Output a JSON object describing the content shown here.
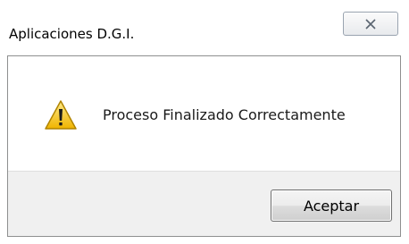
{
  "window": {
    "title": "Aplicaciones  D.G.I.",
    "close_icon": "close-icon"
  },
  "dialog": {
    "icon": "warning-icon",
    "message": "Proceso Finalizado Correctamente",
    "ok_label": "Aceptar"
  },
  "colors": {
    "warning_yellow": "#f5c518",
    "button_border": "#707070",
    "button_area_bg": "#f0f0f0"
  }
}
